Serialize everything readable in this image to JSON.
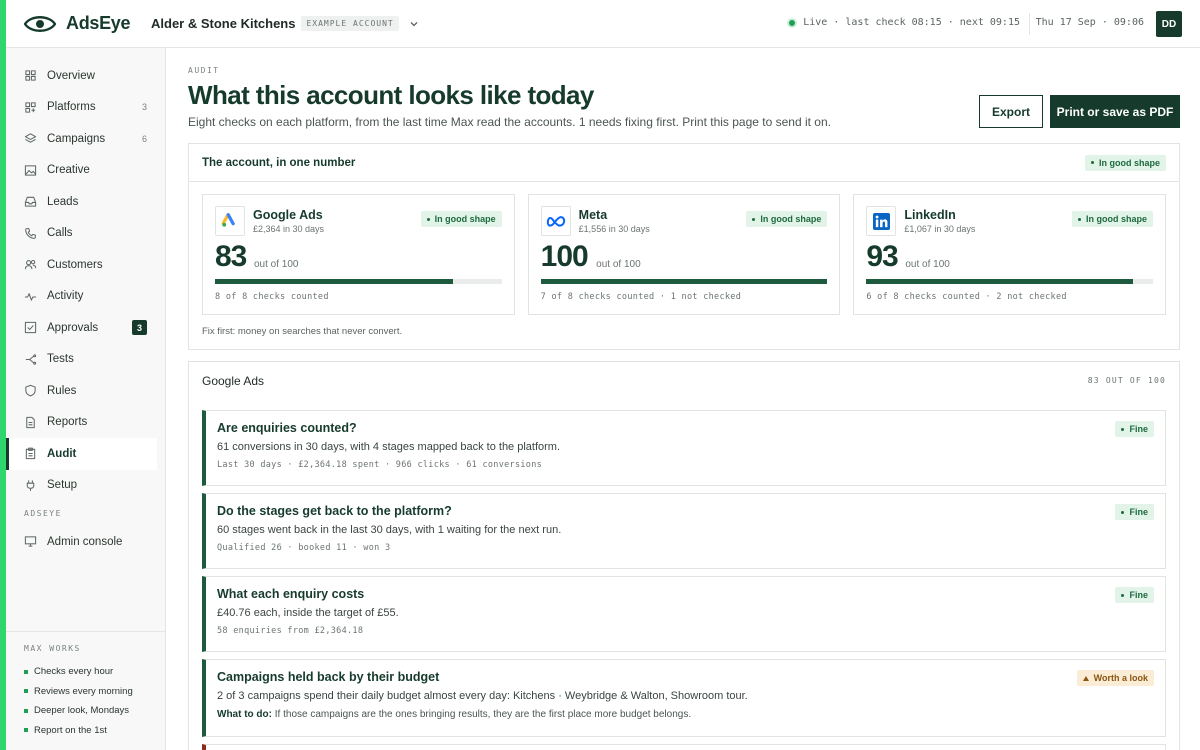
{
  "brand": {
    "name": "AdsEye"
  },
  "account": {
    "name": "Alder & Stone Kitchens",
    "tag": "EXAMPLE ACCOUNT"
  },
  "status": {
    "text": "Live · last check 08:15 · next 09:15"
  },
  "datetime": "Thu 17 Sep · 09:06",
  "user": {
    "initials": "DD"
  },
  "sidebar": {
    "items": [
      {
        "label": "Overview",
        "icon": "grid-icon"
      },
      {
        "label": "Platforms",
        "icon": "platforms-icon",
        "count": "3"
      },
      {
        "label": "Campaigns",
        "icon": "layers-icon",
        "count": "6"
      },
      {
        "label": "Creative",
        "icon": "image-icon"
      },
      {
        "label": "Leads",
        "icon": "inbox-icon"
      },
      {
        "label": "Calls",
        "icon": "phone-icon"
      },
      {
        "label": "Customers",
        "icon": "users-icon"
      },
      {
        "label": "Activity",
        "icon": "pulse-icon"
      },
      {
        "label": "Approvals",
        "icon": "check-square-icon",
        "badge": "3"
      },
      {
        "label": "Tests",
        "icon": "split-icon"
      },
      {
        "label": "Rules",
        "icon": "shield-icon"
      },
      {
        "label": "Reports",
        "icon": "file-icon"
      },
      {
        "label": "Audit",
        "icon": "clipboard-icon",
        "active": true
      },
      {
        "label": "Setup",
        "icon": "plug-icon"
      }
    ],
    "section_label": "ADSEYE",
    "admin": {
      "label": "Admin console",
      "icon": "monitor-icon"
    },
    "footer": {
      "title": "MAX WORKS",
      "items": [
        "Checks every hour",
        "Reviews every morning",
        "Deeper look, Mondays",
        "Report on the 1st"
      ]
    }
  },
  "page": {
    "eyebrow": "AUDIT",
    "title": "What this account looks like today",
    "subtitle": "Eight checks on each platform, from the last time Max read the accounts. 1 needs fixing first. Print this page to send it on.",
    "export_label": "Export",
    "print_label": "Print or save as PDF"
  },
  "score": {
    "title": "The account, in one number",
    "status": "In good shape",
    "out_of": "out of 100",
    "platforms": [
      {
        "name": "Google Ads",
        "spend": "£2,364 in 30 days",
        "status": "In good shape",
        "score": "83",
        "score_pct": 0.83,
        "checks": "8 of 8 checks counted",
        "logo": "google-ads-icon"
      },
      {
        "name": "Meta",
        "spend": "£1,556 in 30 days",
        "status": "In good shape",
        "score": "100",
        "score_pct": 1.0,
        "checks": "7 of 8 checks counted · 1 not checked",
        "logo": "meta-icon"
      },
      {
        "name": "LinkedIn",
        "spend": "£1,067 in 30 days",
        "status": "In good shape",
        "score": "93",
        "score_pct": 0.93,
        "checks": "6 of 8 checks counted · 2 not checked",
        "logo": "linkedin-icon"
      }
    ],
    "fix_first": "Fix first: money on searches that never convert."
  },
  "google_ads": {
    "title": "Google Ads",
    "score_note": "83 OUT OF 100",
    "checks": [
      {
        "title": "Are enquiries counted?",
        "status": "Fine",
        "body": "61 conversions in 30 days, with 4 stages mapped back to the platform.",
        "meta": "Last 30 days · £2,364.18 spent · 966 clicks · 61 conversions"
      },
      {
        "title": "Do the stages get back to the platform?",
        "status": "Fine",
        "body": "60 stages went back in the last 30 days, with 1 waiting for the next run.",
        "meta": "Qualified 26 · booked 11 · won 3"
      },
      {
        "title": "What each enquiry costs",
        "status": "Fine",
        "body": "£40.76 each, inside the target of £55.",
        "meta": "58 enquiries from £2,364.18"
      },
      {
        "title": "Campaigns held back by their budget",
        "status": "Worth a look",
        "body": "2 of 3 campaigns spend their daily budget almost every day: Kitchens · Weybridge & Walton, Showroom tour.",
        "todo_label": "What to do:",
        "todo": "If those campaigns are the ones bringing results, they are the first place more budget belongs."
      }
    ]
  },
  "colors": {
    "brand": "#163b2c",
    "accent": "#2fd66b",
    "good": "#1d6b3f",
    "warn": "#8a5611"
  }
}
